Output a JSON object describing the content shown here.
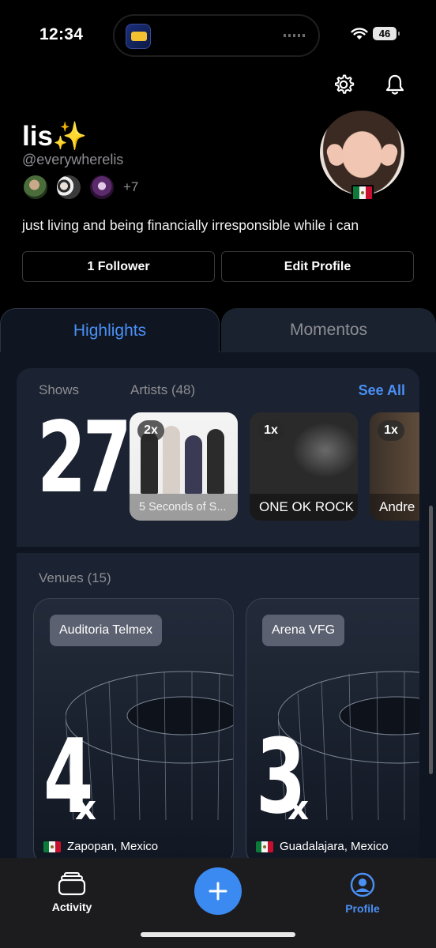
{
  "status_bar": {
    "time": "12:34",
    "battery": "46"
  },
  "profile": {
    "name": "lis✨",
    "handle": "@everywherelis",
    "friends_more": "+7",
    "bio": "just living and being financially irresponsible while i can",
    "followers_label": "1 Follower",
    "edit_label": "Edit Profile"
  },
  "tabs": [
    {
      "label": "Highlights",
      "active": true
    },
    {
      "label": "Momentos",
      "active": false
    }
  ],
  "highlights": {
    "shows_label": "Shows",
    "shows_count": "27",
    "artists_label": "Artists (48)",
    "see_all": "See All",
    "artists": [
      {
        "times": "2x",
        "name": "5 Seconds of S..."
      },
      {
        "times": "1x",
        "name": "ONE OK ROCK"
      },
      {
        "times": "1x",
        "name": "Andre"
      }
    ],
    "venues_label": "Venues (15)",
    "venues": [
      {
        "name": "Auditoria Telmex",
        "count": "4",
        "suffix": "x",
        "location": "Zapopan, Mexico"
      },
      {
        "name": "Arena VFG",
        "count": "3",
        "suffix": "x",
        "location": "Guadalajara, Mexico"
      }
    ]
  },
  "bottom_nav": {
    "activity": "Activity",
    "profile": "Profile"
  },
  "colors": {
    "accent": "#4a90f5",
    "fab": "#3b8af2",
    "card": "#1b2231",
    "panel": "#0f1622"
  }
}
